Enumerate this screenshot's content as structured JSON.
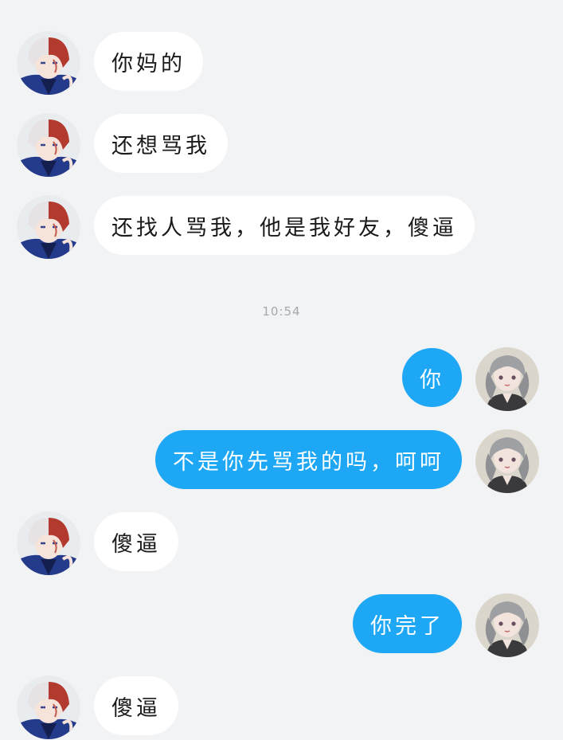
{
  "colors": {
    "background": "#f2f3f5",
    "incoming_bubble": "#ffffff",
    "outgoing_bubble": "#1ea7f5",
    "timestamp_text": "#a6a9ad"
  },
  "messages": [
    {
      "side": "left",
      "text": "你妈的",
      "avatar": "male-anime-avatar"
    },
    {
      "side": "left",
      "text": "还想骂我",
      "avatar": "male-anime-avatar"
    },
    {
      "side": "left",
      "text": "还找人骂我，他是我好友，傻逼",
      "avatar": "male-anime-avatar"
    },
    {
      "side": "right",
      "text": "你",
      "avatar": "female-anime-avatar"
    },
    {
      "side": "right",
      "text": "不是你先骂我的吗，呵呵",
      "avatar": "female-anime-avatar"
    },
    {
      "side": "left",
      "text": "傻逼",
      "avatar": "male-anime-avatar"
    },
    {
      "side": "right",
      "text": "你完了",
      "avatar": "female-anime-avatar"
    },
    {
      "side": "left",
      "text": "傻逼",
      "avatar": "male-anime-avatar"
    }
  ],
  "timestamp": "10:54"
}
